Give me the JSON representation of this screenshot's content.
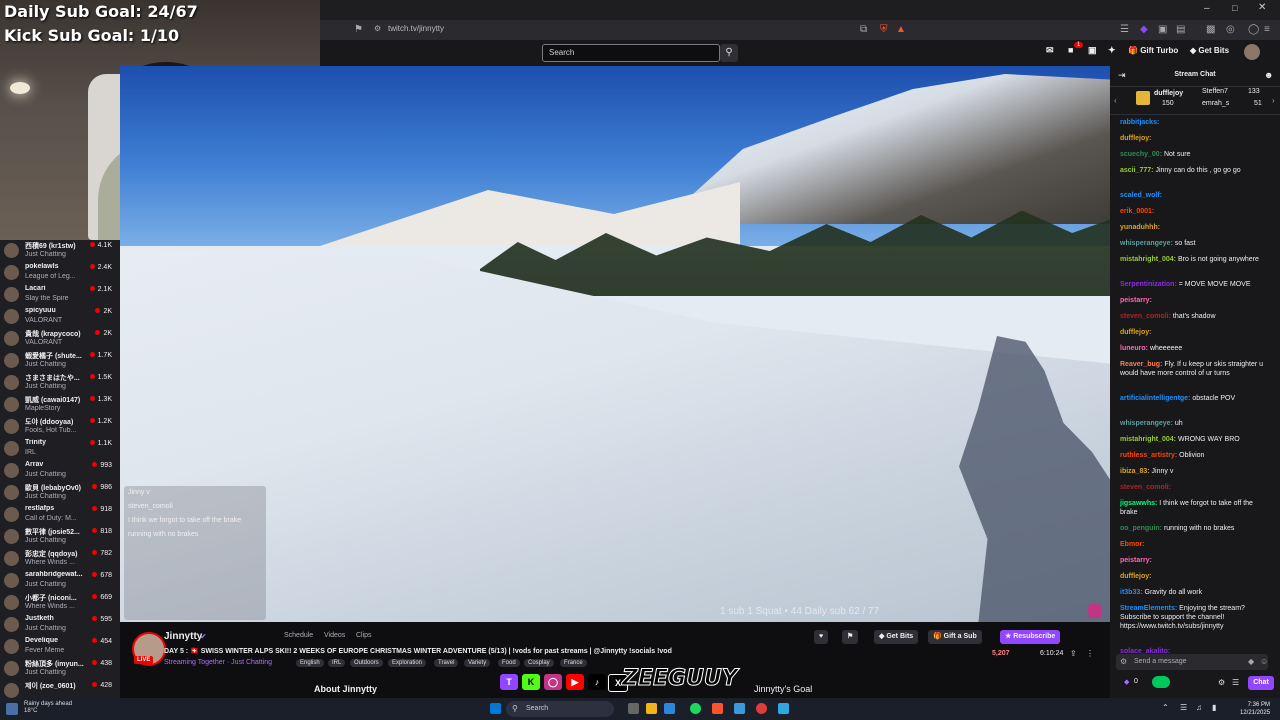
{
  "webcam": {
    "sub_goal_daily": "Daily Sub Goal: 24/67",
    "sub_goal_kick": "Kick Sub Goal: 1/10"
  },
  "browser": {
    "url": "twitch.tv/jinnytty"
  },
  "twitch_nav": {
    "search_placeholder": "Search",
    "gift_turbo": "Gift Turbo",
    "get_bits": "Get Bits",
    "notification_count": "1"
  },
  "video": {
    "overlay_text": "1 sub 1 Squat • 44   Daily sub 62 / 77",
    "ghost_chat": [
      "Jinny v",
      "steven_comoli",
      "I think we forgot to take off the brake",
      "running with no brakes"
    ]
  },
  "sidebar": {
    "channels": [
      {
        "name": "西積69 (kr1stw)",
        "game": "Just Chatting",
        "viewers": "4.1K"
      },
      {
        "name": "pokelawls",
        "game": "League of Leg...",
        "viewers": "2.4K"
      },
      {
        "name": "Lacari",
        "game": "Slay the Spire",
        "viewers": "2.1K"
      },
      {
        "name": "spicyuuu",
        "game": "VALORANT",
        "viewers": "2K"
      },
      {
        "name": "貴哉 (krapycoco)",
        "game": "VALORANT",
        "viewers": "2K"
      },
      {
        "name": "蝦愛橘子 (shute...",
        "game": "Just Chatting",
        "viewers": "1.7K"
      },
      {
        "name": "さまさまはたや...",
        "game": "Just Chatting",
        "viewers": "1.5K"
      },
      {
        "name": "凱威 (cawai0147)",
        "game": "MapleStory",
        "viewers": "1.3K"
      },
      {
        "name": "도야 (ddooyaa)",
        "game": "Fools, Hot Tub...",
        "viewers": "1.2K"
      },
      {
        "name": "Trinity",
        "game": "IRL",
        "viewers": "1.1K"
      },
      {
        "name": "Arrav",
        "game": "Just Chatting",
        "viewers": "993"
      },
      {
        "name": "歐貝 (lebabyOv0)",
        "game": "Just Chatting",
        "viewers": "986"
      },
      {
        "name": "restlafps",
        "game": "Call of Duty: M...",
        "viewers": "918"
      },
      {
        "name": "數平律 (josie52...",
        "game": "Just Chatting",
        "viewers": "818"
      },
      {
        "name": "彭忠定 (qqdoya)",
        "game": "Where Winds ...",
        "viewers": "782"
      },
      {
        "name": "sarahbridgewat...",
        "game": "Just Chatting",
        "viewers": "678"
      },
      {
        "name": "小都子 (niconi...",
        "game": "Where Winds ...",
        "viewers": "669"
      },
      {
        "name": "Justketh",
        "game": "Just Chatting",
        "viewers": "595"
      },
      {
        "name": "Develique",
        "game": "Fever Meme",
        "viewers": "454"
      },
      {
        "name": "粉絲頂多 (imyun...",
        "game": "Just Chatting",
        "viewers": "438"
      },
      {
        "name": "제이 (zoe_0601)",
        "game": "",
        "viewers": "428"
      }
    ]
  },
  "channel": {
    "name": "Jinnytty",
    "links": [
      "Schedule",
      "Videos",
      "Clips"
    ],
    "live_label": "LIVE",
    "title": "DAY 5 : 🇨🇭 SWISS WINTER ALPS SKI!! 2 WEEKS OF EUROPE CHRISTMAS WINTER ADVENTURE (5/13) | !vods for past streams | @Jinnytty !socials !vod",
    "category": "Streaming Together · Just Chatting",
    "tags": [
      "English",
      "IRL",
      "Outdoors",
      "Exploration",
      "Travel",
      "Variety",
      "Food",
      "Cosplay",
      "France"
    ],
    "get_bits": "Get Bits",
    "gift_sub": "Gift a Sub",
    "resubscribe": "Resubscribe",
    "viewers": "5,207",
    "uptime": "6:10:24",
    "about": "About Jinnytty",
    "goal": "Jinnytty's Goal",
    "logo": "ZEEGUUY"
  },
  "chat": {
    "header": "Stream Chat",
    "leaders": [
      {
        "name": "dufflejoy",
        "value": "150"
      },
      {
        "name": "Steffen7",
        "value": "133"
      },
      {
        "name": "emrah_s",
        "value": "51"
      }
    ],
    "messages": [
      {
        "user": "rabbitjacks:",
        "text": "",
        "color": "#1e90ff"
      },
      {
        "user": "dufflejoy:",
        "text": "",
        "color": "#daa520"
      },
      {
        "user": "scuechy_00:",
        "text": "Not sure",
        "color": "#2e8b57"
      },
      {
        "user": "ascii_777:",
        "text": "Jinny can do this , go go go",
        "color": "#9acd32"
      },
      {
        "user": "scaled_wolf:",
        "text": "",
        "color": "#1e90ff"
      },
      {
        "user": "erik_0001:",
        "text": "",
        "color": "#ff4500"
      },
      {
        "user": "yunaduhhh:",
        "text": "",
        "color": "#daa520"
      },
      {
        "user": "whisperangeye:",
        "text": "so fast",
        "color": "#5f9ea0"
      },
      {
        "user": "mistahright_004:",
        "text": "Bro is not going anywhere",
        "color": "#9acd32"
      },
      {
        "user": "Serpentinization:",
        "text": "= MOVE MOVE MOVE",
        "color": "#8a2be2"
      },
      {
        "user": "peistarry:",
        "text": "",
        "color": "#ff69b4"
      },
      {
        "user": "steven_comoli:",
        "text": "that's shadow",
        "color": "#b22222"
      },
      {
        "user": "dufflejoy:",
        "text": "",
        "color": "#daa520"
      },
      {
        "user": "luneuro:",
        "text": "wheeeeee",
        "color": "#ff69b4"
      },
      {
        "user": "Reaver_bug:",
        "text": "Fly. If u keep ur skis straighter u would have more control of ur turns",
        "color": "#ff7f50"
      },
      {
        "user": "artificialintelligentge:",
        "text": "obstacle POV",
        "color": "#1e90ff"
      },
      {
        "user": "whisperangeye:",
        "text": "uh",
        "color": "#5f9ea0"
      },
      {
        "user": "mistahright_004:",
        "text": "WRONG WAY BRO",
        "color": "#9acd32"
      },
      {
        "user": "ruthless_artistry:",
        "text": "Oblivion",
        "color": "#ff4500"
      },
      {
        "user": "ibiza_83:",
        "text": "Jinny v",
        "color": "#daa520"
      },
      {
        "user": "steven_comoli:",
        "text": "",
        "color": "#b22222"
      },
      {
        "user": "jigsawwhs:",
        "text": "I think we forgot to take off the brake",
        "color": "#00ff7f"
      },
      {
        "user": "oo_penguin:",
        "text": "running with no brakes",
        "color": "#2e8b57"
      },
      {
        "user": "Ebmor:",
        "text": "",
        "color": "#ff4500"
      },
      {
        "user": "peistarry:",
        "text": "",
        "color": "#ff69b4"
      },
      {
        "user": "dufflejoy:",
        "text": "",
        "color": "#daa520"
      },
      {
        "user": "it3b33:",
        "text": "Gravity do all work",
        "color": "#1e90ff"
      },
      {
        "user": "StreamElements:",
        "text": "Enjoying the stream? Subscribe to support the channel! https://www.twitch.tv/subs/jinnytty",
        "color": "#1e90ff"
      },
      {
        "user": "solace_akalito:",
        "text": "",
        "color": "#8a2be2"
      }
    ],
    "input_placeholder": "Send a message",
    "points": "0",
    "chat_button": "Chat"
  },
  "taskbar": {
    "weather_line1": "Rainy days ahead",
    "weather_line2": "18°C",
    "search_label": "Search",
    "time": "7:36 PM",
    "date": "12/21/2025"
  }
}
